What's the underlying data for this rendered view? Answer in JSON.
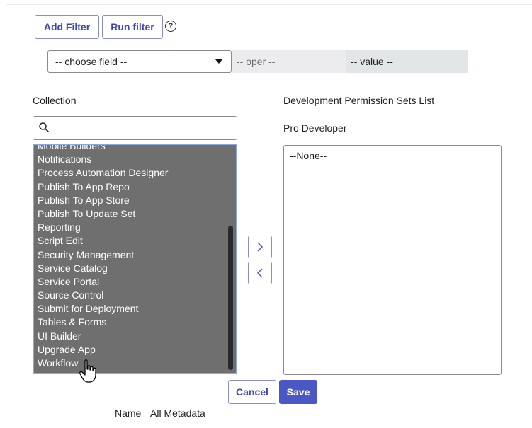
{
  "filter": {
    "add_filter_label": "Add Filter",
    "run_filter_label": "Run filter",
    "help_glyph": "?",
    "field_select": "-- choose field --",
    "oper": "-- oper --",
    "value": "-- value --"
  },
  "collection": {
    "label": "Collection",
    "search_value": "",
    "items": [
      "Mobile Builders",
      "Notifications",
      "Process Automation Designer",
      "Publish To App Repo",
      "Publish To App Store",
      "Publish To Update Set",
      "Reporting",
      "Script Edit",
      "Security Management",
      "Service Catalog",
      "Service Portal",
      "Source Control",
      "Submit for Deployment",
      "Tables & Forms",
      "UI Builder",
      "Upgrade App",
      "Workflow"
    ]
  },
  "target": {
    "label": "Development Permission Sets List",
    "sublabel": "Pro Developer",
    "items": [
      "--None--"
    ]
  },
  "actions": {
    "add_arrow": ">",
    "remove_arrow": "<",
    "cancel_label": "Cancel",
    "save_label": "Save"
  },
  "footer": {
    "name_label": "Name",
    "name_value": "All Metadata"
  },
  "colors": {
    "accent": "#4b57c4",
    "list_bg": "#6f6f6f",
    "focus_border": "#8aa8e6"
  }
}
